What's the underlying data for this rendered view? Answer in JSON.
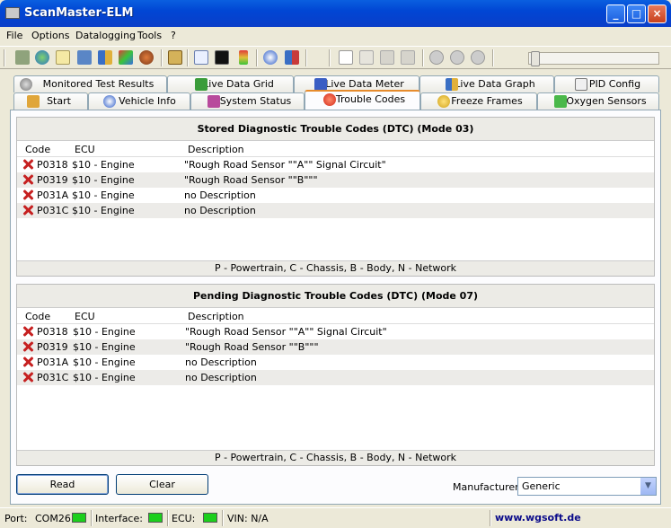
{
  "window": {
    "title": "ScanMaster-ELM",
    "min": "_",
    "max": "□",
    "close": "×"
  },
  "menu": [
    "File",
    "Options",
    "Datalogging",
    "Tools",
    "?"
  ],
  "tabs_row1": [
    {
      "label": "Monitored Test Results",
      "icon": "test-icon"
    },
    {
      "label": "Live Data Grid",
      "icon": "grid-icon"
    },
    {
      "label": "Live Data Meter",
      "icon": "meter-icon"
    },
    {
      "label": "Live Data Graph",
      "icon": "graph-icon"
    },
    {
      "label": "PID Config",
      "icon": "config-icon"
    }
  ],
  "tabs_row2": [
    {
      "label": "Start",
      "icon": "start-icon"
    },
    {
      "label": "Vehicle Info",
      "icon": "info-icon"
    },
    {
      "label": "System Status",
      "icon": "status-icon"
    },
    {
      "label": "Trouble Codes",
      "icon": "error-icon",
      "active": true
    },
    {
      "label": "Freeze Frames",
      "icon": "freeze-icon"
    },
    {
      "label": "Oxygen Sensors",
      "icon": "oxygen-icon"
    }
  ],
  "stored": {
    "title": "Stored Diagnostic Trouble Codes (DTC) (Mode 03)",
    "cols": [
      "Code",
      "ECU",
      "Description"
    ],
    "rows": [
      {
        "code": "P0318",
        "ecu": "$10 - Engine",
        "desc": "\"Rough Road Sensor \"\"A\"\" Signal Circuit\""
      },
      {
        "code": "P0319",
        "ecu": "$10 - Engine",
        "desc": "\"Rough Road Sensor \"\"B\"\"\""
      },
      {
        "code": "P031A",
        "ecu": "$10 - Engine",
        "desc": "no Description"
      },
      {
        "code": "P031C",
        "ecu": "$10 - Engine",
        "desc": "no Description"
      }
    ],
    "footer": "P - Powertrain, C - Chassis, B - Body, N - Network"
  },
  "pending": {
    "title": "Pending Diagnostic Trouble Codes (DTC) (Mode 07)",
    "cols": [
      "Code",
      "ECU",
      "Description"
    ],
    "rows": [
      {
        "code": "P0318",
        "ecu": "$10 - Engine",
        "desc": "\"Rough Road Sensor \"\"A\"\" Signal Circuit\""
      },
      {
        "code": "P0319",
        "ecu": "$10 - Engine",
        "desc": "\"Rough Road Sensor \"\"B\"\"\""
      },
      {
        "code": "P031A",
        "ecu": "$10 - Engine",
        "desc": "no Description"
      },
      {
        "code": "P031C",
        "ecu": "$10 - Engine",
        "desc": "no Description"
      }
    ],
    "footer": "P - Powertrain, C - Chassis, B - Body, N - Network"
  },
  "buttons": {
    "read": "Read",
    "clear": "Clear"
  },
  "manufacturer": {
    "label": "Manufacturer",
    "value": "Generic",
    "arrow": "▼"
  },
  "status": {
    "port_label": "Port:",
    "port_value": "COM26",
    "interface_label": "Interface:",
    "ecu_label": "ECU:",
    "vin": "VIN: N/A",
    "url": "www.wgsoft.de"
  },
  "colors": {
    "title_bar": "#0146d4",
    "led_on": "#1ccf1c",
    "error_x": "#c62020",
    "active_tab_accent": "#e68b2c"
  }
}
